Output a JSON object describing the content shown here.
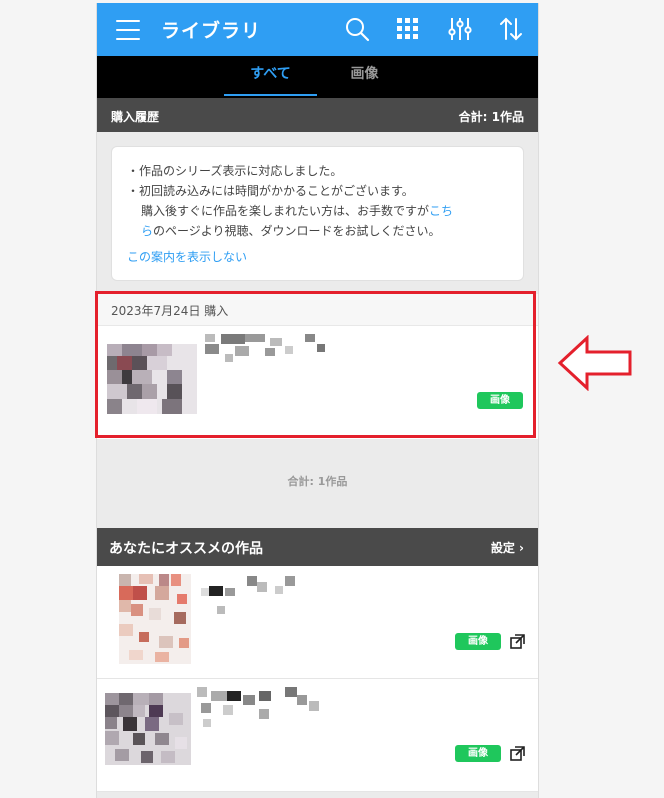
{
  "header": {
    "title": "ライブラリ",
    "icons": [
      "menu-icon",
      "search-icon",
      "grid-icon",
      "filter-sliders-icon",
      "sort-icon"
    ]
  },
  "tabs": [
    {
      "label": "すべて",
      "active": true
    },
    {
      "label": "画像",
      "active": false
    }
  ],
  "history": {
    "label": "購入履歴",
    "total": "合計: 1作品"
  },
  "notice": {
    "line1": "・作品のシリーズ表示に対応しました。",
    "line2": "・初回読み込みには時間がかかることがございます。",
    "line3_pre": "購入後すぐに作品を楽しまれたい方は、お手数ですが",
    "line3_link": "こち",
    "line4_link": "ら",
    "line4_post": "のページより視聴、ダウンロードをお試しください。",
    "dismiss": "この案内を表示しない"
  },
  "purchase": {
    "date": "2023年7月24日 購入",
    "badge": "画像"
  },
  "footer_total": "合計: 1作品",
  "recommend": {
    "title": "あなたにオススメの作品",
    "settings": "設定",
    "items": [
      {
        "badge": "画像"
      },
      {
        "badge": "画像"
      }
    ]
  },
  "colors": {
    "accent": "#2f9ef3",
    "badge": "#1fc75c",
    "highlight": "#e4202c"
  }
}
